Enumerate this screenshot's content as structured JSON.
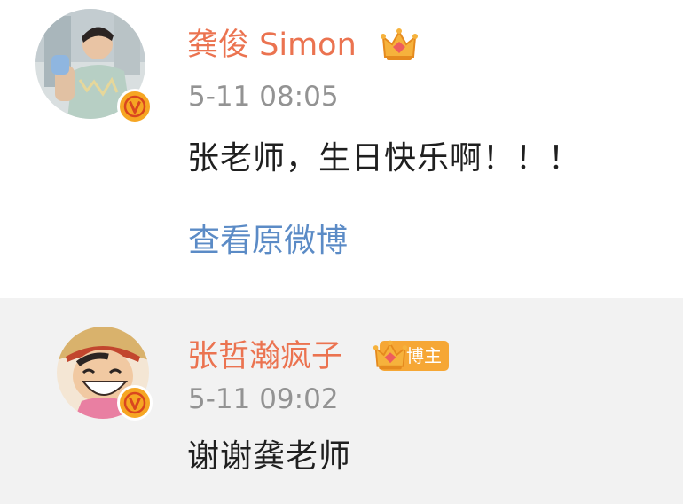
{
  "comments": [
    {
      "username": "龚俊 Simon",
      "timestamp": "5-11 08:05",
      "text": "张老师，生日快乐啊！！！",
      "link": "查看原微博"
    },
    {
      "username": "张哲瀚疯子",
      "badge": "博主",
      "timestamp": "5-11 09:02",
      "text": "谢谢龚老师"
    }
  ],
  "colors": {
    "username": "#eb7350",
    "timestamp": "#939393",
    "link": "#5b8bc6",
    "text": "#1f1f1f",
    "verified_badge": "#f6a623",
    "reply_background": "#f2f2f2"
  },
  "icons": {
    "verified": "verified-v-icon",
    "vip": "crown-icon"
  }
}
